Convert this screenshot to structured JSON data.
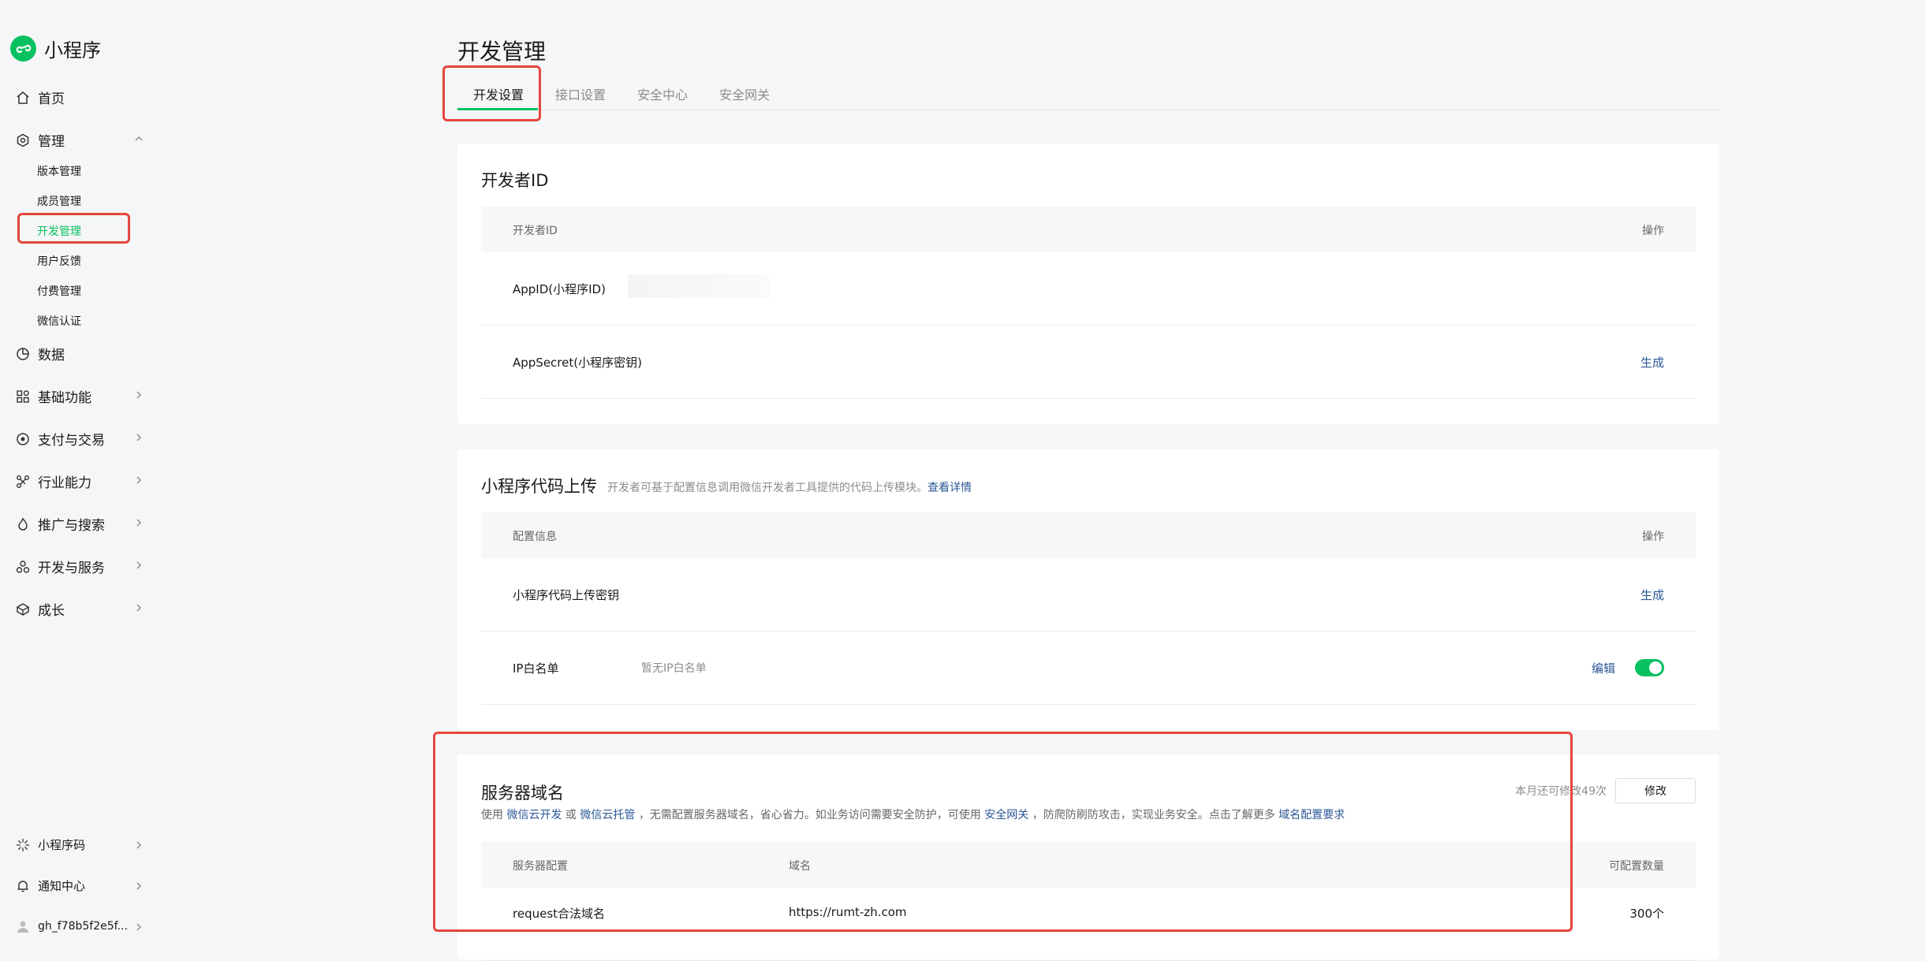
{
  "app": {
    "title": "小程序"
  },
  "sidebar": {
    "home": "首页",
    "manage": "管理",
    "sub_items": [
      "版本管理",
      "成员管理",
      "开发管理",
      "用户反馈",
      "付费管理",
      "微信认证"
    ],
    "data": "数据",
    "basic": "基础功能",
    "pay": "支付与交易",
    "industry": "行业能力",
    "promote": "推广与搜索",
    "devservice": "开发与服务",
    "growth": "成长",
    "qrcode": "小程序码",
    "notify": "通知中心",
    "account": "gh_f78b5f2e5f..."
  },
  "page": {
    "title": "开发管理"
  },
  "tabs": [
    "开发设置",
    "接口设置",
    "安全中心",
    "安全网关"
  ],
  "developer_id": {
    "title": "开发者ID",
    "col_name": "开发者ID",
    "col_action": "操作",
    "appid_label": "AppID(小程序ID)",
    "secret_label": "AppSecret(小程序密钥)",
    "secret_action": "生成"
  },
  "code_upload": {
    "title": "小程序代码上传",
    "desc": "开发者可基于配置信息调用微信开发者工具提供的代码上传模块。",
    "desc_link": "查看详情",
    "col_name": "配置信息",
    "col_action": "操作",
    "key_label": "小程序代码上传密钥",
    "key_action": "生成",
    "ip_label": "IP白名单",
    "ip_value": "暂无IP白名单",
    "ip_action": "编辑"
  },
  "server_domain": {
    "title": "服务器域名",
    "remaining": "本月还可修改49次",
    "modify": "修改",
    "desc_1": "使用",
    "link_1": "微信云开发",
    "desc_2": "或",
    "link_2": "微信云托管",
    "desc_3": "，无需配置服务器域名，省心省力。如业务访问需要安全防护，可使用",
    "link_3": "安全网关",
    "desc_4": "，防爬防刷防攻击，实现业务安全。点击了解更多",
    "link_4": "域名配置要求",
    "col_config": "服务器配置",
    "col_domain": "域名",
    "col_count": "可配置数量",
    "row_label": "request合法域名",
    "row_domain": "https://rumt-zh.com",
    "row_count": "300个"
  },
  "colors": {
    "accent": "#07c160",
    "link": "#2b5797",
    "highlight": "#e5463d"
  }
}
